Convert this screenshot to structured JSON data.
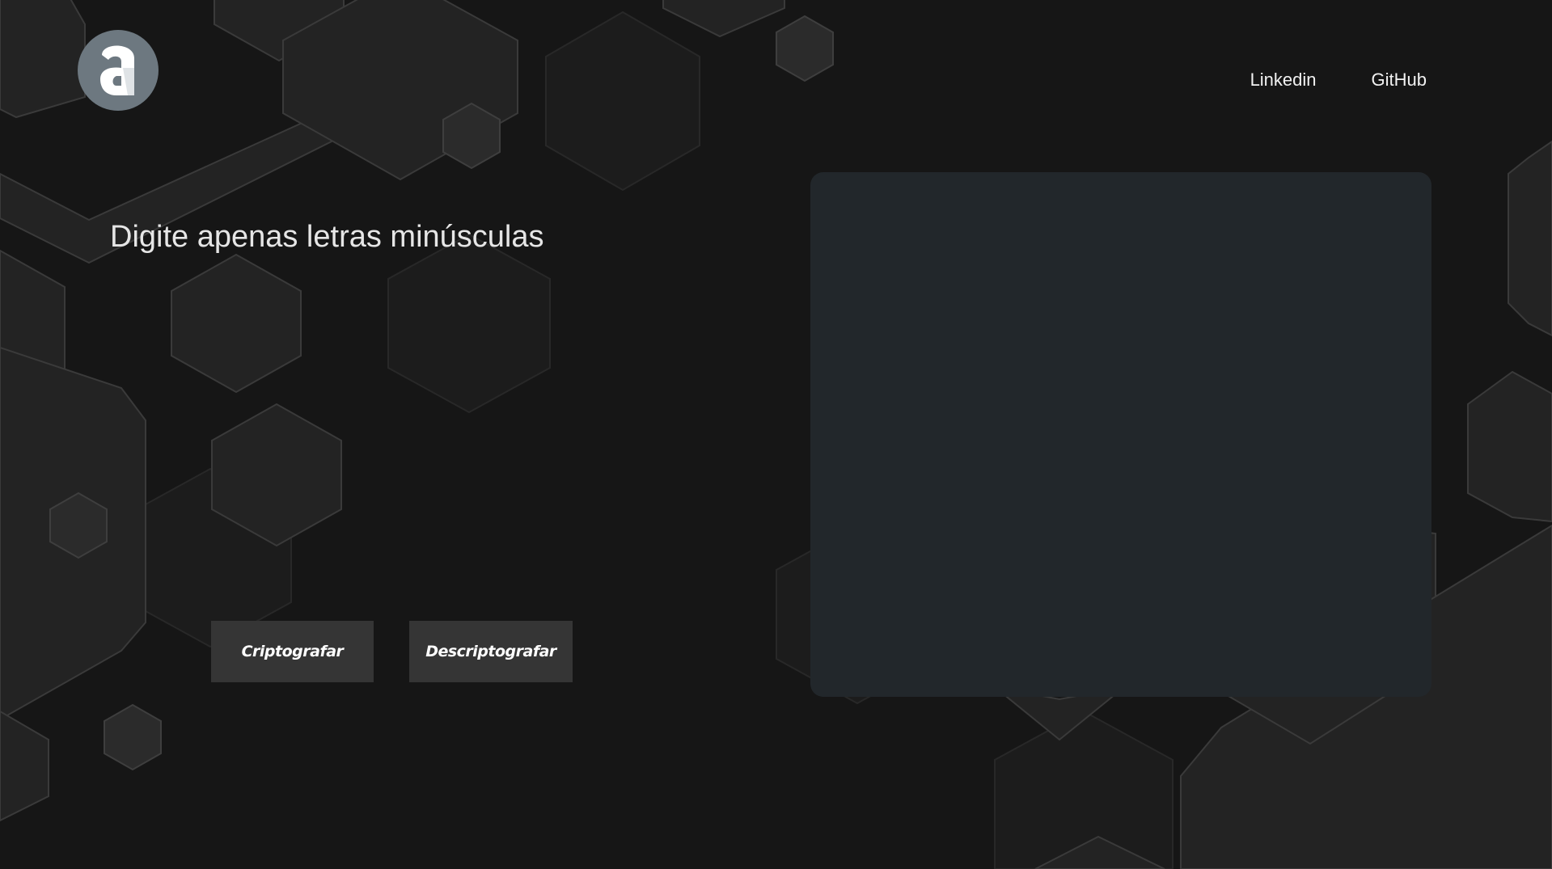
{
  "header": {
    "logo_icon": "alura-a-logo-icon",
    "nav": [
      {
        "label": "Linkedin"
      },
      {
        "label": "GitHub"
      }
    ]
  },
  "main": {
    "input": {
      "placeholder": "Digite apenas letras minúsculas",
      "value": ""
    },
    "buttons": {
      "encrypt_label": "Criptografar",
      "decrypt_label": "Descriptografar"
    },
    "output": {
      "text": ""
    }
  },
  "colors": {
    "background": "#161616",
    "hexagon": "#262626",
    "panel": "#22272b",
    "button": "#353535",
    "logo": "#6d7880"
  }
}
